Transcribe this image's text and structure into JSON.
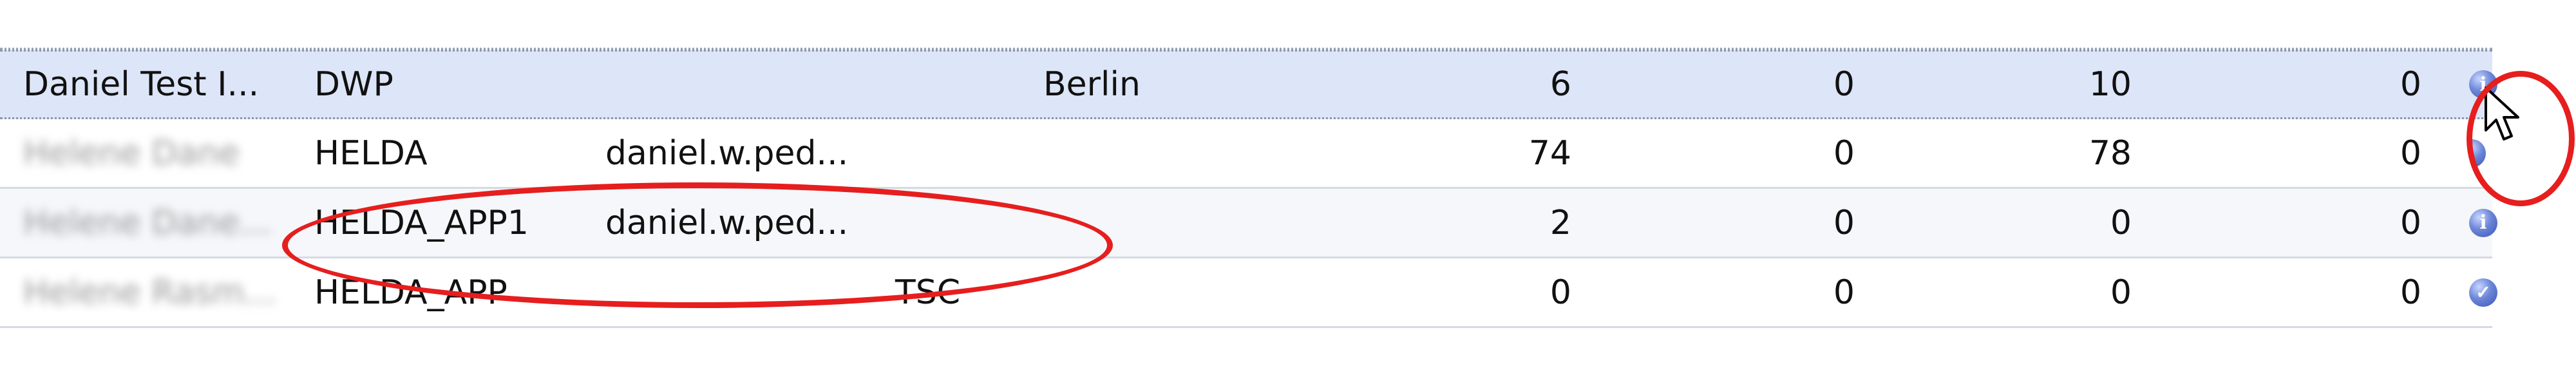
{
  "rows": [
    {
      "name": "Daniel Test I...",
      "group": "DWP",
      "email": "",
      "location": "Berlin",
      "n1": "6",
      "n2": "0",
      "n3": "10",
      "n4": "0",
      "icon": "info-icon",
      "selected": true
    },
    {
      "name": "Helene Dane",
      "group": "HELDA",
      "email": "daniel.w.ped...",
      "location": "",
      "n1": "74",
      "n2": "0",
      "n3": "78",
      "n4": "0",
      "icon": "info-icon"
    },
    {
      "name": "Helene Dane...",
      "group": "HELDA_APP1",
      "email": "daniel.w.ped...",
      "location": "",
      "n1": "2",
      "n2": "0",
      "n3": "0",
      "n4": "0",
      "icon": "info-icon"
    },
    {
      "name": "Helene Rasm...",
      "group": "HELDA_APP",
      "email": "",
      "location": "TSC",
      "n1": "0",
      "n2": "0",
      "n3": "0",
      "n4": "0",
      "icon": "check-icon"
    }
  ],
  "colors": {
    "selected_row": "#dde5f8",
    "annotation": "#e61e1e",
    "icon_blue": "#3a55b4"
  }
}
